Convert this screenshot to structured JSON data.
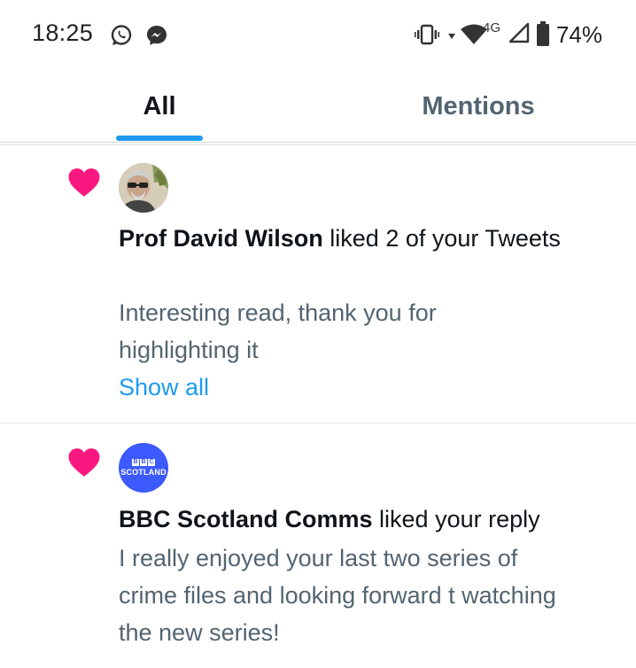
{
  "status_bar": {
    "time": "18:25",
    "battery": "74%",
    "network": "4G",
    "icons": [
      "whatsapp-icon",
      "messenger-icon",
      "vibrate-icon",
      "wifi-icon",
      "signal-icon",
      "battery-icon"
    ]
  },
  "tabs": [
    {
      "label": "All",
      "active": true
    },
    {
      "label": "Mentions",
      "active": false
    }
  ],
  "notifications": [
    {
      "icon": "heart-icon",
      "name": "Prof David Wilson",
      "action": " liked 2 of your Tweets",
      "preview": "Interesting read, thank you for highlighting it",
      "link": "Show all"
    },
    {
      "icon": "heart-icon",
      "name": "BBC Scotland Comms",
      "action": " liked your reply",
      "preview": "I really enjoyed your last two series of crime files and looking forward t watching the new series!",
      "avatar_blocks": [
        "B",
        "B",
        "C"
      ],
      "avatar_word": "SCOTLAND"
    }
  ],
  "colors": {
    "accent": "#1d9bf0",
    "heart": "#f91880",
    "secondary_text": "#536471",
    "bbc_blue": "#3d5afe"
  }
}
